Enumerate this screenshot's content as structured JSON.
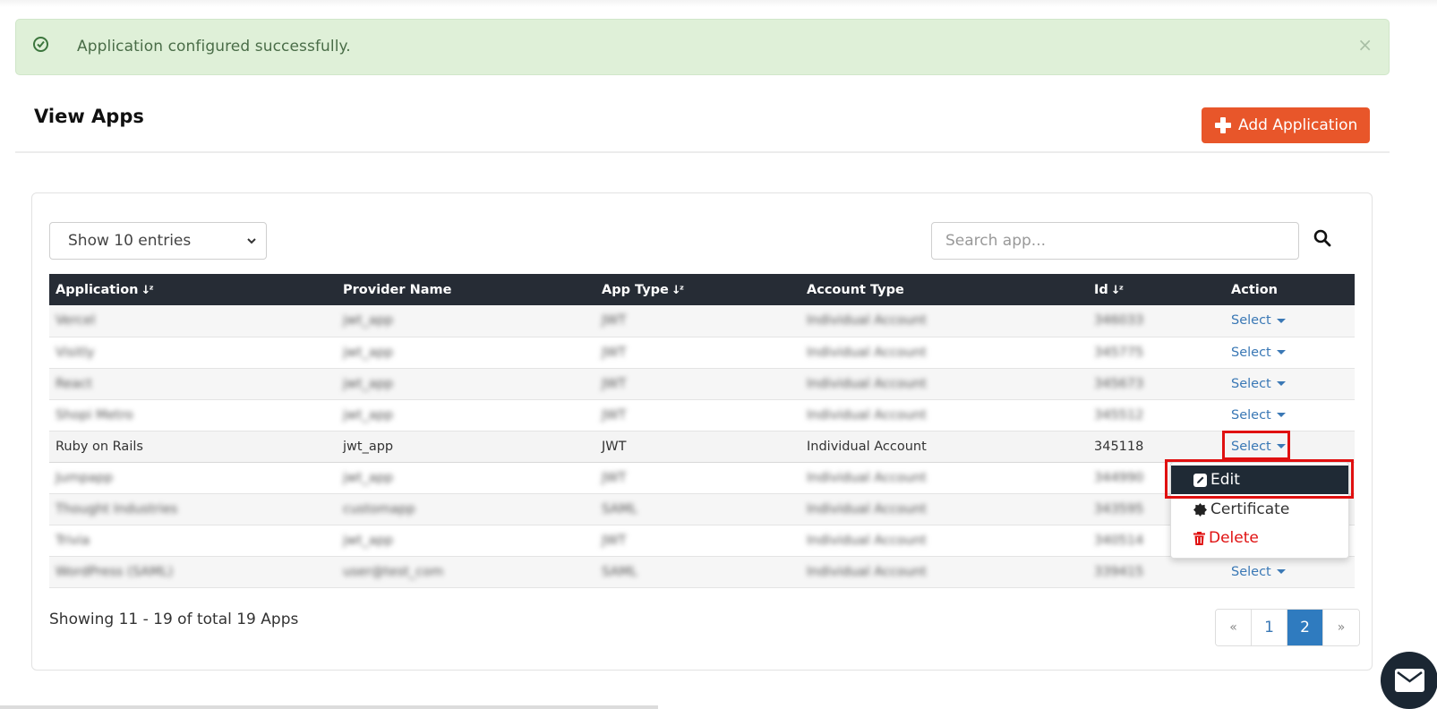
{
  "alert": {
    "icon": "check-circle-icon",
    "message": "Application configured successfully.",
    "close_label": "×",
    "color": "#dff0d8"
  },
  "header": {
    "title": "View Apps",
    "add_button_label": "Add Application",
    "add_button_icon": "plus-icon",
    "accent": "#e8562a"
  },
  "controls": {
    "entries_selected": "Show 10 entries",
    "search_placeholder": "Search app...",
    "search_value": ""
  },
  "table": {
    "columns": [
      {
        "label": "Application",
        "sortable": true
      },
      {
        "label": "Provider Name",
        "sortable": false
      },
      {
        "label": "App Type",
        "sortable": true
      },
      {
        "label": "Account Type",
        "sortable": false
      },
      {
        "label": "Id",
        "sortable": true
      },
      {
        "label": "Action",
        "sortable": false
      }
    ],
    "sort_glyph": "↓ᶻ",
    "action_label": "Select",
    "rows": [
      {
        "application": "Vercel",
        "provider": "jwt_app",
        "app_type": "JWT",
        "account_type": "Individual Account",
        "id": "346033",
        "blurred": true
      },
      {
        "application": "Visitly",
        "provider": "jwt_app",
        "app_type": "JWT",
        "account_type": "Individual Account",
        "id": "345775",
        "blurred": true
      },
      {
        "application": "React",
        "provider": "jwt_app",
        "app_type": "JWT",
        "account_type": "Individual Account",
        "id": "345673",
        "blurred": true
      },
      {
        "application": "Shopi Metro",
        "provider": "jwt_app",
        "app_type": "JWT",
        "account_type": "Individual Account",
        "id": "345512",
        "blurred": true
      },
      {
        "application": "Ruby on Rails",
        "provider": "jwt_app",
        "app_type": "JWT",
        "account_type": "Individual Account",
        "id": "345118",
        "blurred": false
      },
      {
        "application": "Jumpapp",
        "provider": "jwt_app",
        "app_type": "JWT",
        "account_type": "Individual Account",
        "id": "344990",
        "blurred": true
      },
      {
        "application": "Thought Industries",
        "provider": "customapp",
        "app_type": "SAML",
        "account_type": "Individual Account",
        "id": "343595",
        "blurred": true
      },
      {
        "application": "Trivia",
        "provider": "jwt_app",
        "app_type": "JWT",
        "account_type": "Individual Account",
        "id": "340514",
        "blurred": true
      },
      {
        "application": "WordPress (SAML)",
        "provider": "user@test_com",
        "app_type": "SAML",
        "account_type": "Individual Account",
        "id": "339415",
        "blurred": true
      }
    ]
  },
  "dropdown": {
    "items": [
      {
        "label": "Edit",
        "icon": "pencil-square-icon"
      },
      {
        "label": "Certificate",
        "icon": "certificate-icon"
      },
      {
        "label": "Delete",
        "icon": "trash-icon"
      }
    ]
  },
  "footer": {
    "showing_text": "Showing 11 - 19 of total 19 Apps",
    "pagination": {
      "prev": "«",
      "pages": [
        "1",
        "2"
      ],
      "active_page": "2",
      "next": "»"
    }
  },
  "chat_widget": {
    "icon": "envelope-icon"
  }
}
